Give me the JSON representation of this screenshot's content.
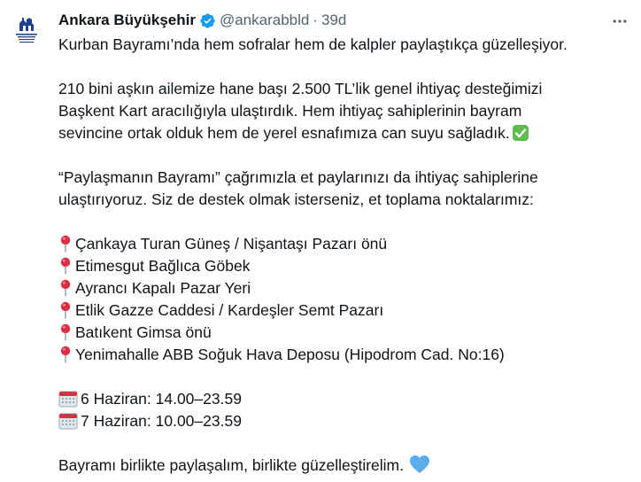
{
  "author": {
    "display_name": "Ankara Büyükşehir",
    "handle": "@ankarabbld",
    "separator": "·",
    "time": "39d",
    "avatar_text": "ANKARA BÜYÜKŞEHİR BELEDİYESİ"
  },
  "icons": {
    "verified": "verified-badge-icon",
    "more": "more-options-icon",
    "pin": "round-pushpin-icon",
    "calendar": "calendar-icon",
    "check": "check-mark-button-icon",
    "heart": "blue-heart-icon"
  },
  "colors": {
    "text": "#0f1419",
    "muted": "#536471",
    "verified": "#1d9bf0",
    "brand": "#1e3f8a"
  },
  "tweet": {
    "para1": "Kurban Bayramı’nda hem sofralar hem de kalpler paylaştıkça güzelleşiyor.",
    "para2_lines": [
      "210 bini aşkın ailemize hane başı 2.500 TL’lik genel ihtiyaç desteğimizi",
      "Başkent Kart aracılığıyla ulaştırdık. Hem ihtiyaç sahiplerinin bayram",
      "sevincine ortak olduk hem de yerel esnafımıza can suyu sağladık."
    ],
    "para3_lines": [
      "“Paylaşmanın Bayramı” çağrımızla et paylarınızı da ihtiyaç sahiplerine",
      "ulaştırıyoruz. Siz de destek olmak isterseniz, et toplama noktalarımız:"
    ],
    "locations": [
      "Çankaya Turan Güneş / Nişantaşı Pazarı önü",
      "Etimesgut Bağlıca Göbek",
      "Ayrancı Kapalı Pazar Yeri",
      "Etlik Gazze Caddesi / Kardeşler Semt Pazarı",
      "Batıkent Gimsa önü",
      "Yenimahalle ABB Soğuk Hava Deposu (Hipodrom Cad. No:16)"
    ],
    "dates": [
      "6 Haziran: 14.00–23.59",
      "7 Haziran: 10.00–23.59"
    ],
    "closing": "Bayramı birlikte paylaşalım, birlikte güzelleştirelim."
  }
}
